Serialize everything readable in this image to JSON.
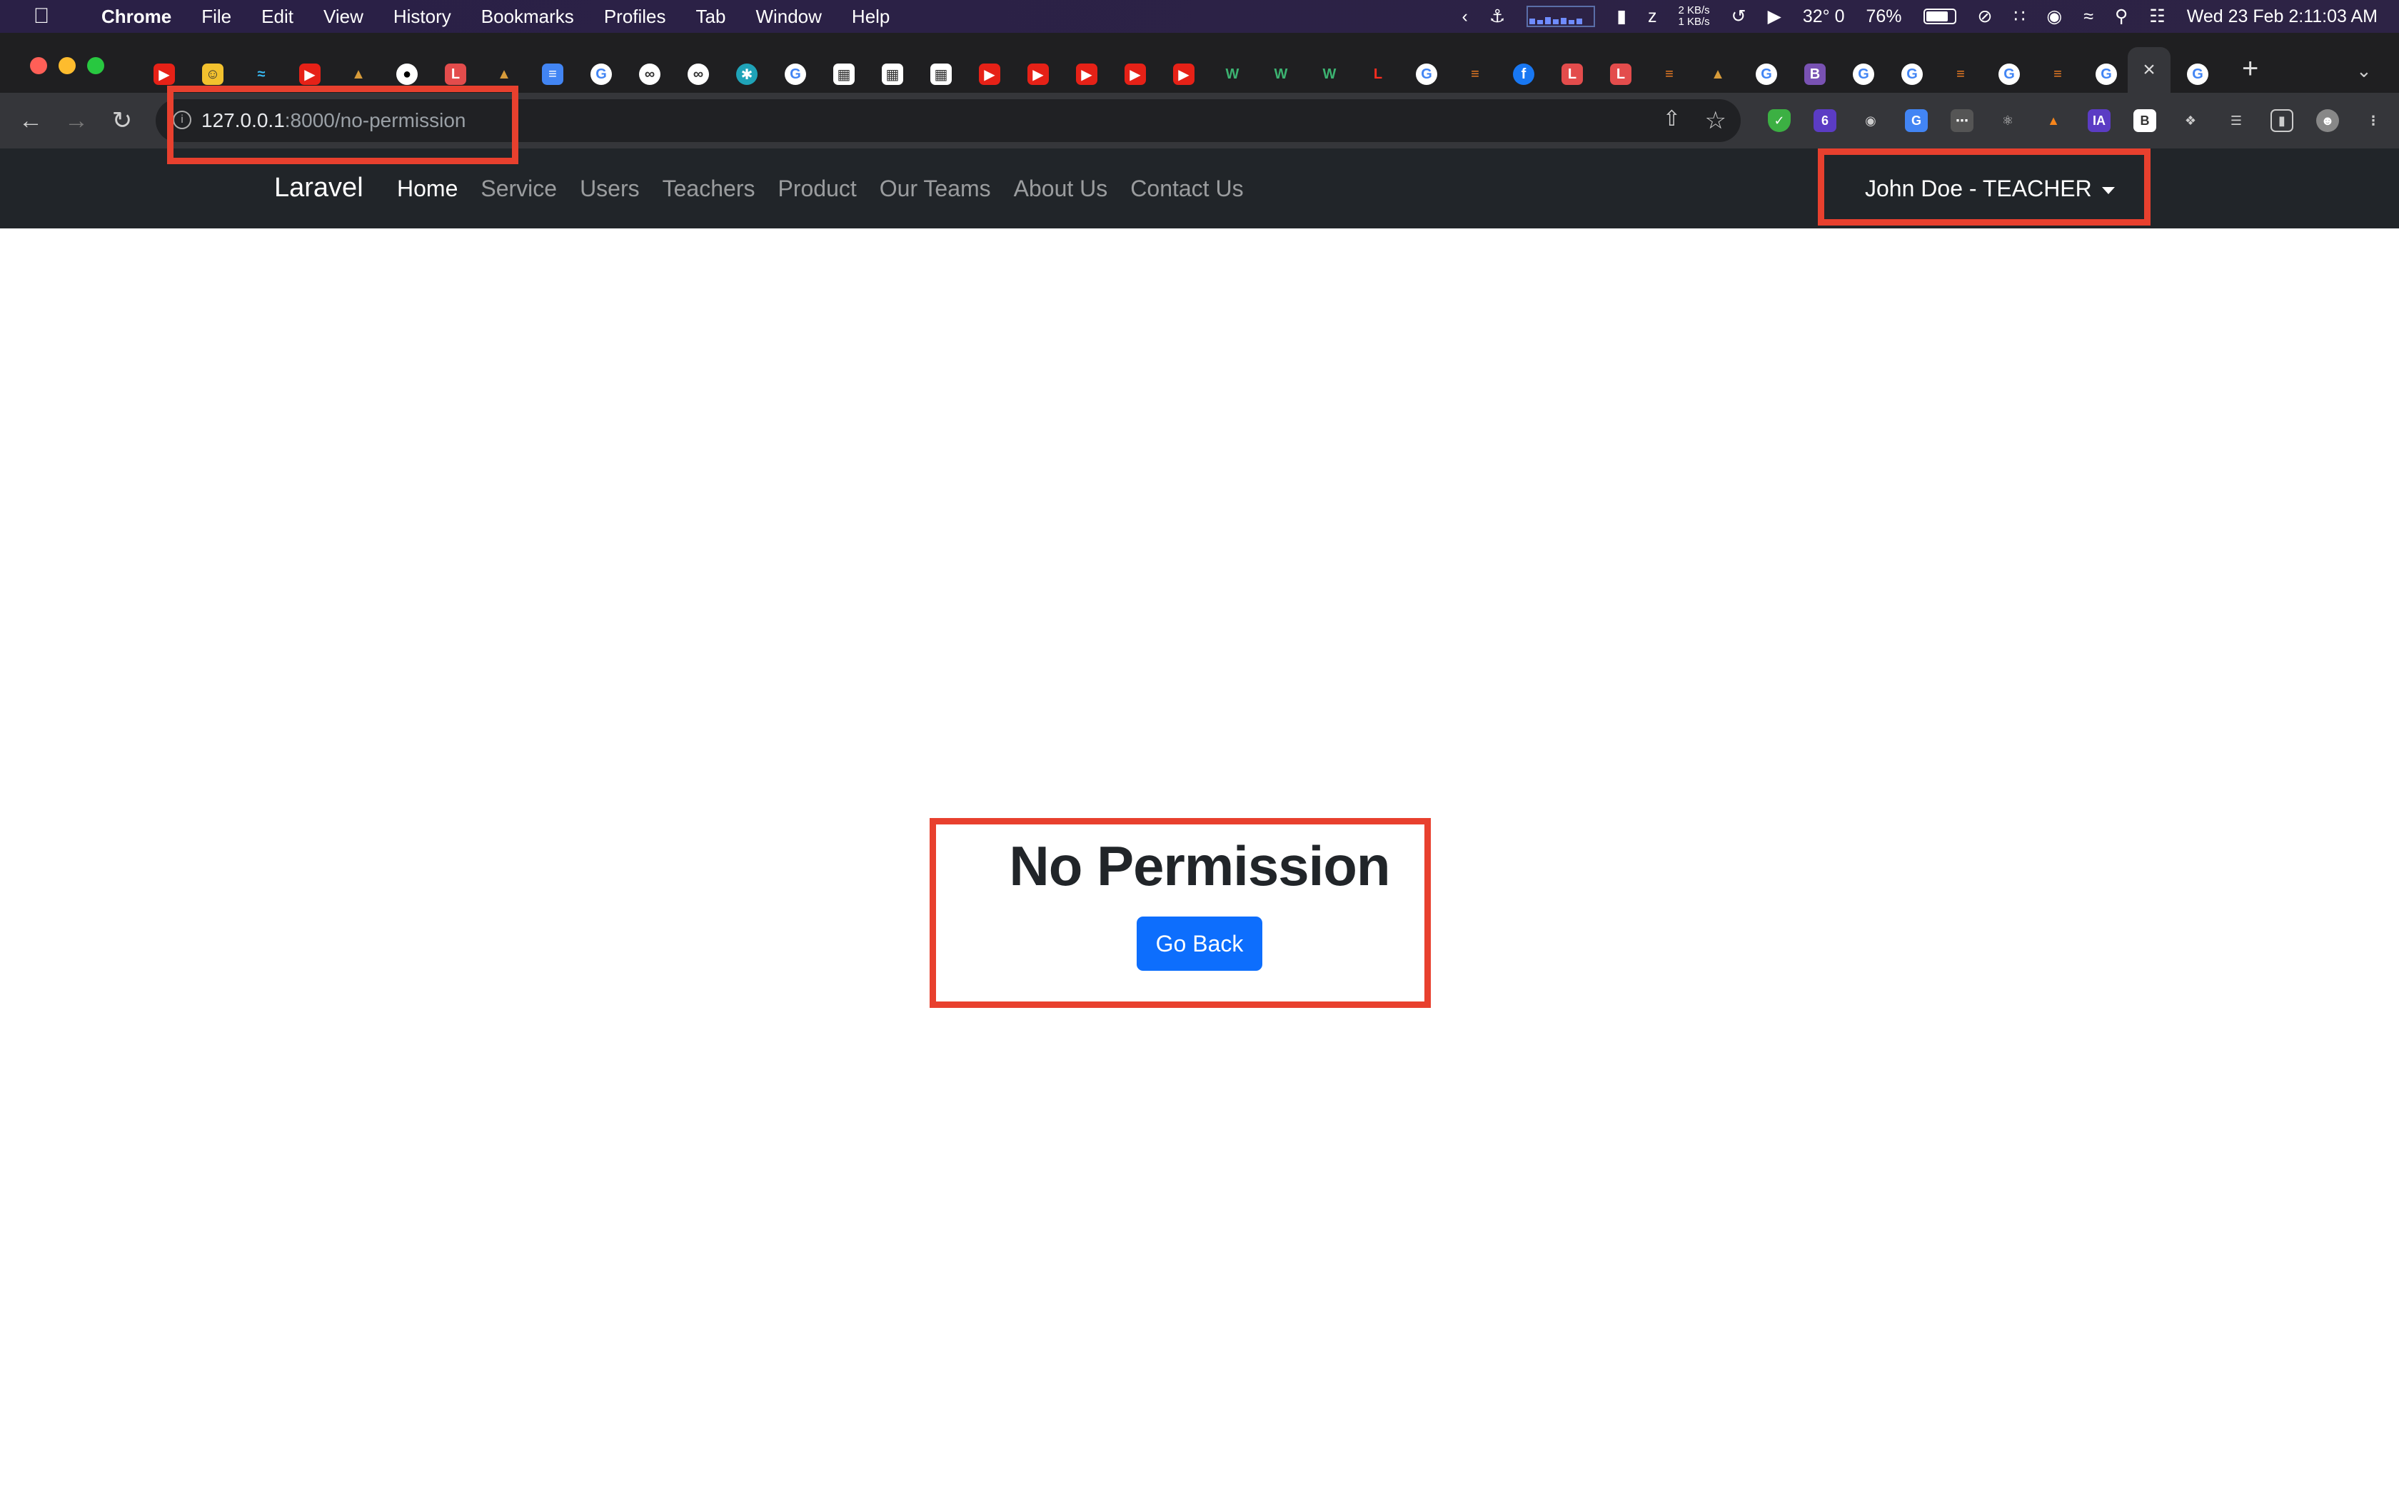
{
  "menubar": {
    "app": "Chrome",
    "items": [
      "File",
      "Edit",
      "View",
      "History",
      "Bookmarks",
      "Profiles",
      "Tab",
      "Window",
      "Help"
    ],
    "net_up": "2 KB/s",
    "net_down": "1 KB/s",
    "temp": "32° 0",
    "battery": "76%",
    "datetime": "Wed 23 Feb  2:11:03 AM"
  },
  "browser": {
    "url_host": "127.0.0.1",
    "url_path": ":8000/no-permission",
    "active_tab_close": "×",
    "new_tab": "+"
  },
  "navbar": {
    "brand": "Laravel",
    "links": [
      "Home",
      "Service",
      "Users",
      "Teachers",
      "Product",
      "Our Teams",
      "About Us",
      "Contact Us"
    ],
    "user": "John Doe - TEACHER"
  },
  "main": {
    "title": "No Permission",
    "button": "Go Back"
  },
  "colors": {
    "navbar_bg": "#212529",
    "primary_button": "#0d6efd",
    "annotation": "#e8402e"
  }
}
